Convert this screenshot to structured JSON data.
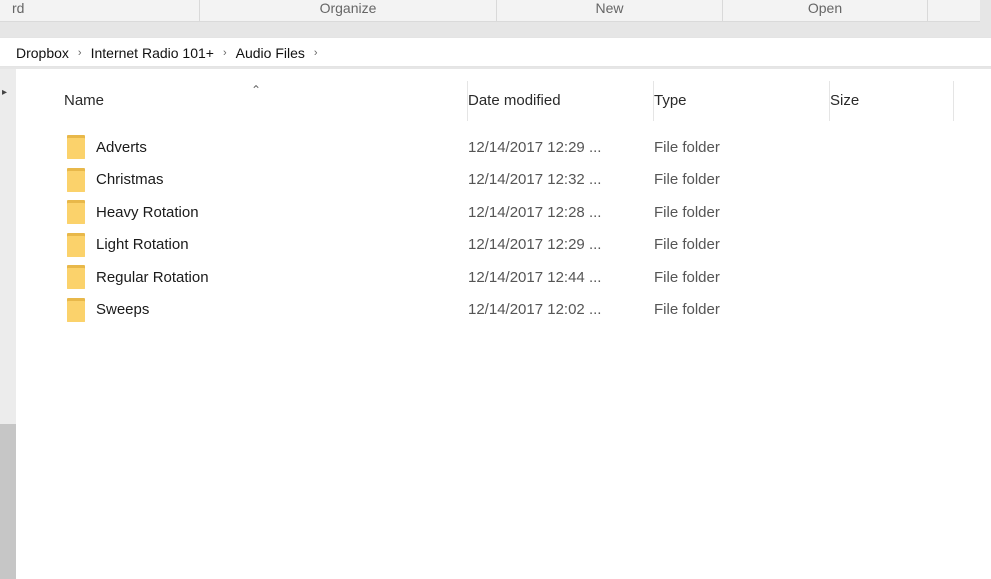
{
  "ribbon": {
    "groups": [
      {
        "label": "rd"
      },
      {
        "label": "Organize"
      },
      {
        "label": "New"
      },
      {
        "label": "Open"
      }
    ]
  },
  "breadcrumb": {
    "items": [
      "Dropbox",
      "Internet Radio 101+",
      "Audio Files"
    ],
    "separator": "›"
  },
  "columns": {
    "name": "Name",
    "date": "Date modified",
    "type": "Type",
    "size": "Size"
  },
  "files": [
    {
      "name": "Adverts",
      "date": "12/14/2017 12:29 ...",
      "type": "File folder"
    },
    {
      "name": "Christmas",
      "date": "12/14/2017 12:32 ...",
      "type": "File folder"
    },
    {
      "name": "Heavy Rotation",
      "date": "12/14/2017 12:28 ...",
      "type": "File folder"
    },
    {
      "name": "Light Rotation",
      "date": "12/14/2017 12:29 ...",
      "type": "File folder"
    },
    {
      "name": "Regular Rotation",
      "date": "12/14/2017 12:44 ...",
      "type": "File folder"
    },
    {
      "name": "Sweeps",
      "date": "12/14/2017 12:02 ...",
      "type": "File folder"
    }
  ],
  "icons": {
    "folder": "folder-icon",
    "sort": "sort-up-icon",
    "breadcrumb_sep": "chevron-right-icon"
  },
  "colors": {
    "folder_front": "#fbd26b",
    "folder_back": "#e8b84a"
  }
}
